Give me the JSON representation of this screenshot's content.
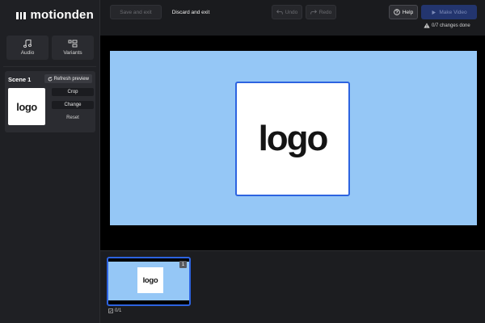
{
  "brand": {
    "name": "motionden"
  },
  "sidebar": {
    "tools": [
      {
        "label": "Audio",
        "icon": "music-note-icon"
      },
      {
        "label": "Variants",
        "icon": "variants-icon"
      }
    ],
    "scene": {
      "title": "Scene 1",
      "refresh_label": "Refresh preview",
      "thumb_text": "logo",
      "actions": {
        "crop": "Crop",
        "change": "Change",
        "reset": "Reset"
      }
    }
  },
  "toolbar": {
    "save_exit": "Save and exit",
    "discard_exit": "Discard and exit",
    "undo": "Undo",
    "redo": "Redo",
    "help": "Help",
    "make_video": "Make Video",
    "changes_status": "0/7 changes done"
  },
  "preview": {
    "logo_text": "logo",
    "background_color": "#95c7f6"
  },
  "timeline": {
    "scenes": [
      {
        "number": "1",
        "logo_text": "logo"
      }
    ],
    "count_label": "0/1"
  },
  "colors": {
    "accent": "#2d63e0",
    "canvas_bg": "#95c7f6",
    "sidebar_bg": "#1f2024"
  }
}
